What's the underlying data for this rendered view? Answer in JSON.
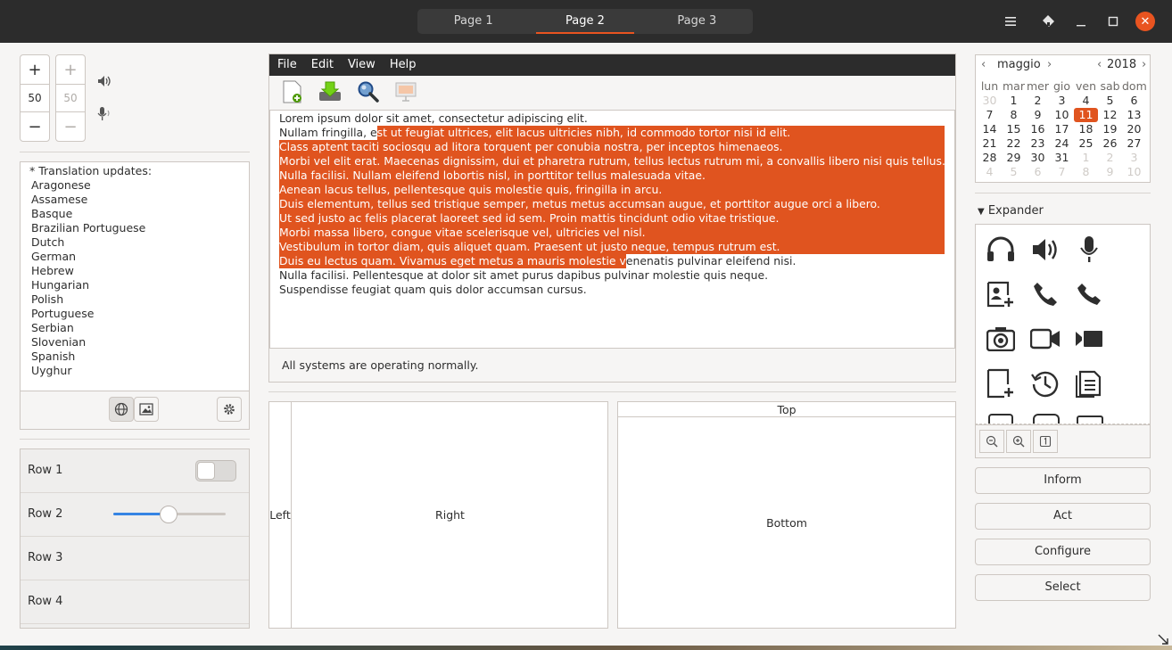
{
  "header": {
    "tabs": [
      {
        "label": "Page 1"
      },
      {
        "label": "Page 2"
      },
      {
        "label": "Page 3"
      }
    ]
  },
  "spinners": {
    "a_value": "50",
    "b_value": "50"
  },
  "translations": {
    "header": "* Translation updates:",
    "items": [
      "Aragonese",
      "Assamese",
      "Basque",
      "Brazilian Portuguese",
      "Dutch",
      "German",
      "Hebrew",
      "Hungarian",
      "Polish",
      "Portuguese",
      "Serbian",
      "Slovenian",
      "Spanish",
      "Uyghur"
    ]
  },
  "rows": [
    {
      "label": "Row 1"
    },
    {
      "label": "Row 2"
    },
    {
      "label": "Row 3"
    },
    {
      "label": "Row 4"
    }
  ],
  "slider": {
    "value_fraction": 0.49
  },
  "menu": {
    "file": "File",
    "edit": "Edit",
    "view": "View",
    "help": "Help"
  },
  "text": {
    "lines": [
      {
        "pre": "Lorem ipsum dolor sit amet, consectetur adipiscing elit.",
        "sel": "",
        "post": ""
      },
      {
        "pre": "Nullam fringilla, e",
        "sel": "st ut feugiat ultrices, elit lacus ultricies nibh, id commodo tortor nisi id elit.",
        "post": ""
      },
      {
        "pre": "",
        "sel": "Class aptent taciti sociosqu ad litora torquent per conubia nostra, per inceptos himenaeos.",
        "post": ""
      },
      {
        "pre": "",
        "sel": "Morbi vel elit erat. Maecenas dignissim, dui et pharetra rutrum, tellus lectus rutrum mi, a convallis libero nisi quis tellus.",
        "post": ""
      },
      {
        "pre": "",
        "sel": "Nulla facilisi. Nullam eleifend lobortis nisl, in porttitor tellus malesuada vitae.",
        "post": ""
      },
      {
        "pre": "",
        "sel": "Aenean lacus tellus, pellentesque quis molestie quis, fringilla in arcu.",
        "post": ""
      },
      {
        "pre": "",
        "sel": "Duis elementum, tellus sed tristique semper, metus metus accumsan augue, et porttitor augue orci a libero.",
        "post": ""
      },
      {
        "pre": "",
        "sel": "Ut sed justo ac felis placerat laoreet sed id sem. Proin mattis tincidunt odio vitae tristique.",
        "post": ""
      },
      {
        "pre": "",
        "sel": "Morbi massa libero, congue vitae scelerisque vel, ultricies vel nisl.",
        "post": ""
      },
      {
        "pre": "",
        "sel": "Vestibulum in tortor diam, quis aliquet quam. Praesent ut justo neque, tempus rutrum est.",
        "post": ""
      },
      {
        "pre": "",
        "sel": "Duis eu lectus quam. Vivamus eget metus a mauris molestie v",
        "post": "enenatis pulvinar eleifend nisi."
      },
      {
        "pre": "Nulla facilisi. Pellentesque at dolor sit amet purus dapibus pulvinar molestie quis neque.",
        "sel": "",
        "post": ""
      },
      {
        "pre": "Suspendisse feugiat quam quis dolor accumsan cursus.",
        "sel": "",
        "post": ""
      }
    ]
  },
  "status": "All systems are operating normally.",
  "panes": {
    "left": "Left",
    "right": "Right",
    "top": "Top",
    "bottom": "Bottom"
  },
  "calendar": {
    "month": "maggio",
    "year": "2018",
    "weekdays": [
      "lun",
      "mar",
      "mer",
      "gio",
      "ven",
      "sab",
      "dom"
    ],
    "weeks": [
      [
        "30",
        "1",
        "2",
        "3",
        "4",
        "5",
        "6"
      ],
      [
        "7",
        "8",
        "9",
        "10",
        "11",
        "12",
        "13"
      ],
      [
        "14",
        "15",
        "16",
        "17",
        "18",
        "19",
        "20"
      ],
      [
        "21",
        "22",
        "23",
        "24",
        "25",
        "26",
        "27"
      ],
      [
        "28",
        "29",
        "30",
        "31",
        "1",
        "2",
        "3"
      ],
      [
        "4",
        "5",
        "6",
        "7",
        "8",
        "9",
        "10"
      ]
    ],
    "today": "11"
  },
  "expander": {
    "label": "Expander"
  },
  "buttons": {
    "inform": "Inform",
    "act": "Act",
    "configure": "Configure",
    "select": "Select"
  },
  "icons": [
    "headphones-icon",
    "speaker-icon",
    "microphone-icon",
    "address-book-new-icon",
    "call-start-icon",
    "call-end-icon",
    "camera-photo-icon",
    "camera-video-icon",
    "camera-web-icon",
    "document-new-icon",
    "history-icon",
    "document-properties-icon"
  ],
  "colors": {
    "accent": "#e95420",
    "selection": "#e0541f",
    "headerbar": "#2c2c2c"
  }
}
